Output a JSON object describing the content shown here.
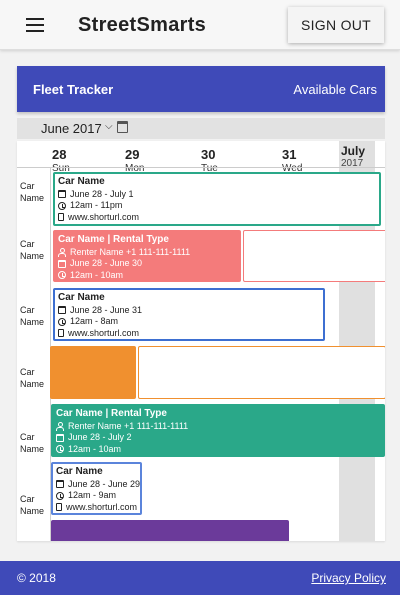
{
  "app": {
    "title": "StreetSmarts",
    "signout_label": "SIGN OUT"
  },
  "fleet": {
    "title": "Fleet Tracker",
    "available_label": "Available Cars"
  },
  "month": {
    "label": "June 2017"
  },
  "days": [
    {
      "num": "28",
      "name": "Sun"
    },
    {
      "num": "29",
      "name": "Mon"
    },
    {
      "num": "30",
      "name": "Tue"
    },
    {
      "num": "31",
      "name": "Wed"
    }
  ],
  "july": {
    "name": "July",
    "year": "2017"
  },
  "row_label": "Car Name",
  "bookings": [
    {
      "title": "Car Name",
      "dates": "June 28 - July 1",
      "time": "12am - 11pm",
      "url": "www.shorturl.com"
    },
    {
      "title": "Car Name | Rental Type",
      "renter": "Renter Name +1 111-111-1111",
      "dates": "June 28 - June 30",
      "time": "12am - 10am"
    },
    {
      "title": "Car Name",
      "dates": "June 28 - June 31",
      "time": "12am - 8am",
      "url": "www.shorturl.com"
    },
    {
      "title": "Car Name | Rental Type",
      "renter": "Renter Name +1 111-111-1111",
      "dates": "June 28 - July 2",
      "time": "12am - 10am"
    },
    {
      "title": "Car Name",
      "dates": "June 28 - June 29",
      "time": "12am - 9am",
      "url": "www.shorturl.com"
    }
  ],
  "colors": {
    "primary": "#3f4ab8",
    "green": "#2aa889",
    "coral": "#f47b7b",
    "blue": "#3d6fd1",
    "orange": "#f0902f",
    "purple": "#6b3a9a"
  },
  "footer": {
    "copyright": "© 2018",
    "privacy": "Privacy Policy"
  }
}
